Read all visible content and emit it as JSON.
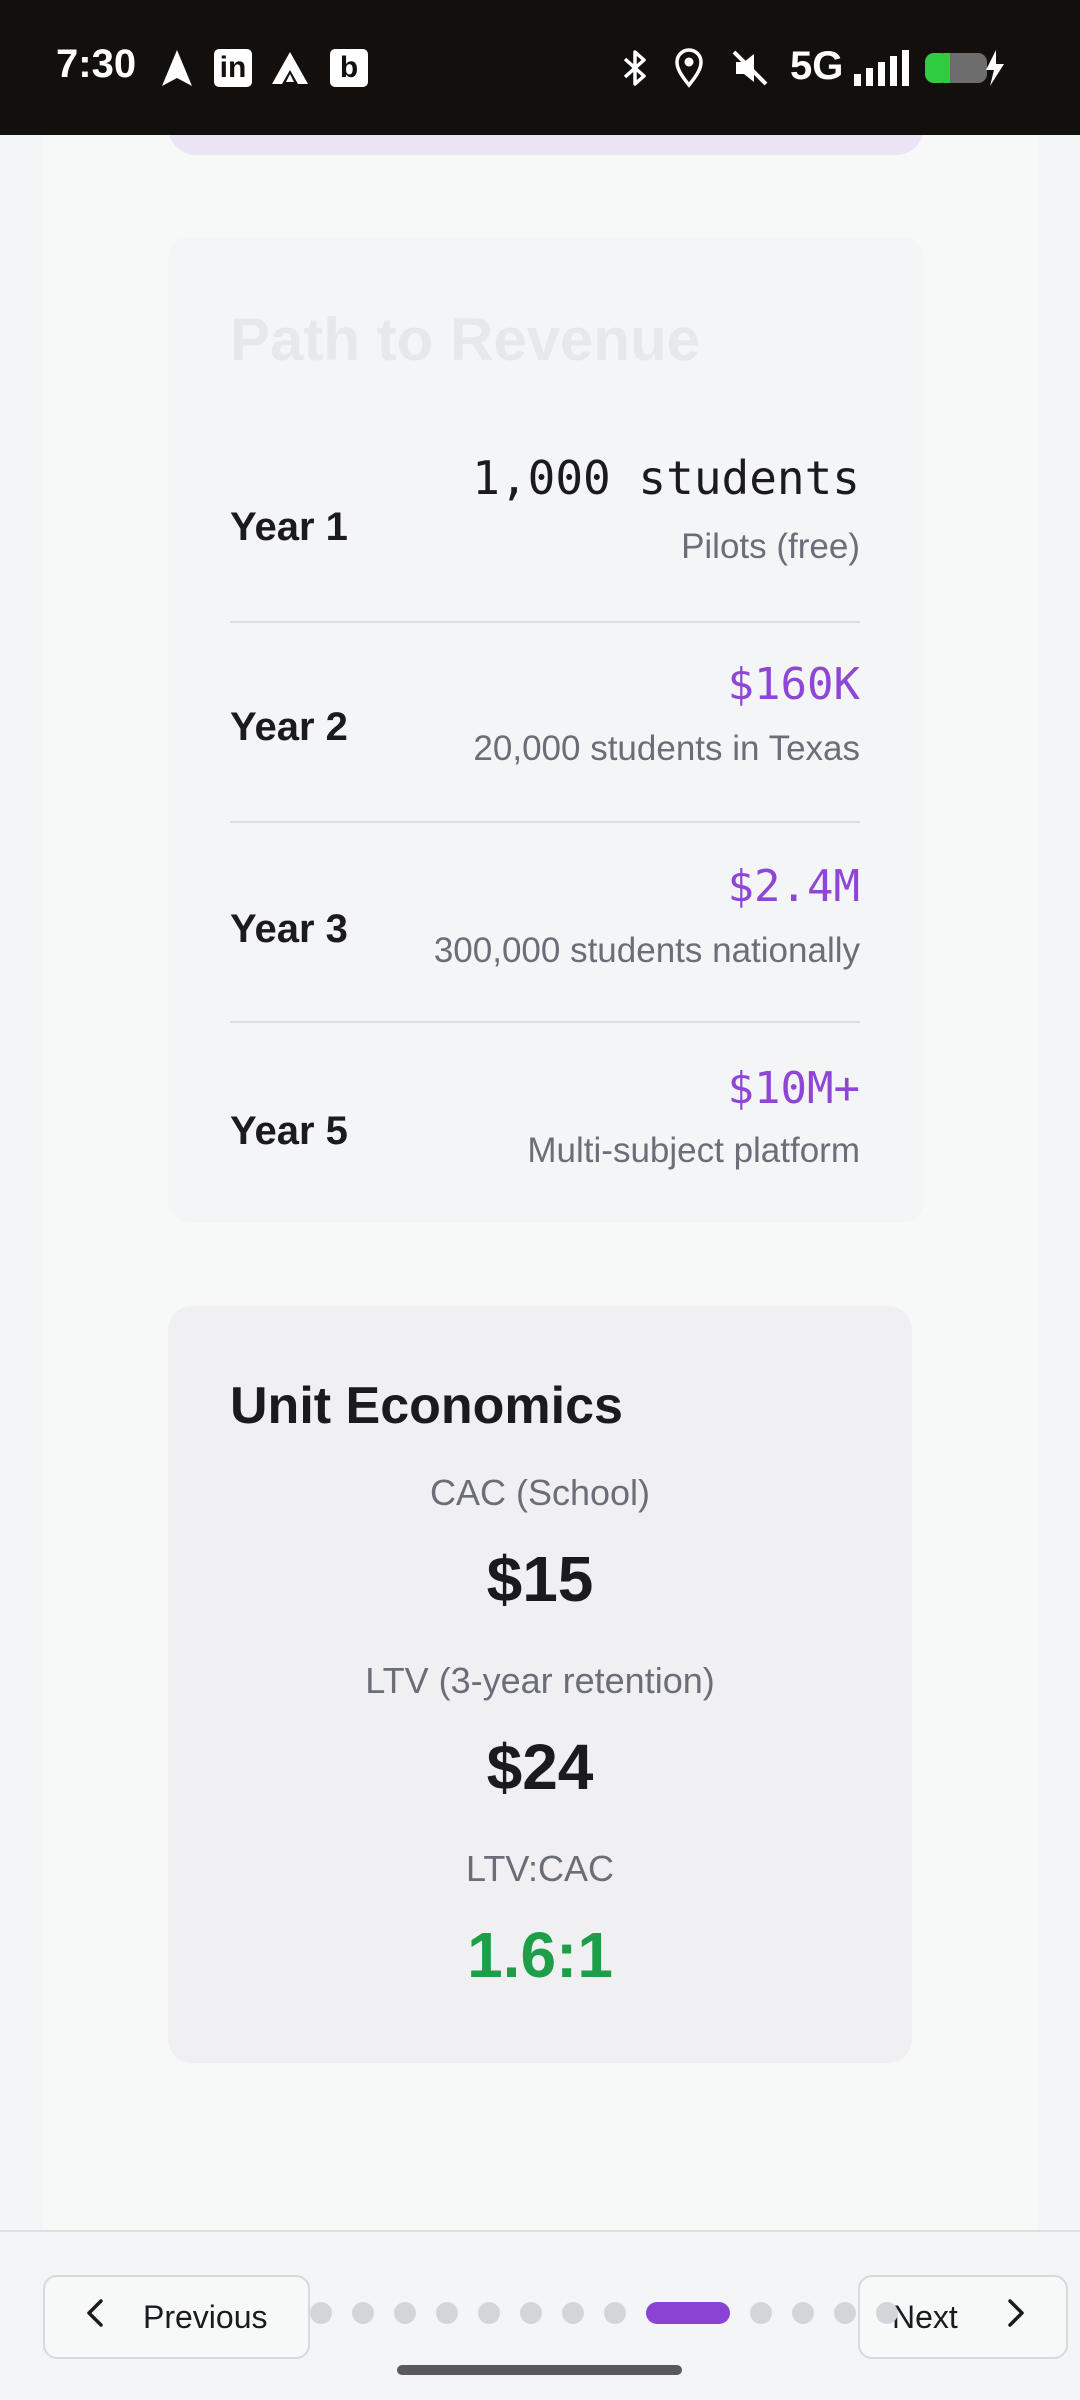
{
  "status_bar": {
    "time": "7:30",
    "network": "5G",
    "icons": [
      "navigation-icon",
      "linkedin-icon",
      "app-icon",
      "b-app-icon",
      "bluetooth-icon",
      "location-icon",
      "mute-icon",
      "signal-icon",
      "battery-charging-icon"
    ],
    "linkedin_glyph": "in",
    "b_glyph": "b"
  },
  "revenue": {
    "title": "Path to Revenue",
    "rows": [
      {
        "year": "Year 1",
        "value": "1,000 students",
        "desc": "Pilots (free)"
      },
      {
        "year": "Year 2",
        "value": "$160K",
        "desc": "20,000 students in Texas"
      },
      {
        "year": "Year 3",
        "value": "$2.4M",
        "desc": "300,000 students nationally"
      },
      {
        "year": "Year 5",
        "value": "$10M+",
        "desc": "Multi-subject platform"
      }
    ]
  },
  "unit_economics": {
    "title": "Unit Economics",
    "metrics": [
      {
        "label": "CAC (School)",
        "value": "$15"
      },
      {
        "label": "LTV (3-year retention)",
        "value": "$24"
      },
      {
        "label": "LTV:CAC",
        "value": "1.6:1"
      }
    ]
  },
  "navigation": {
    "previous_label": "Previous",
    "next_label": "Next",
    "total_slides": 13,
    "current_slide": 9
  },
  "colors": {
    "accent": "#8b43d3",
    "value_purple": "#8f45d6",
    "positive_green": "#1f9e4a",
    "status_bar": "#130f0c"
  }
}
